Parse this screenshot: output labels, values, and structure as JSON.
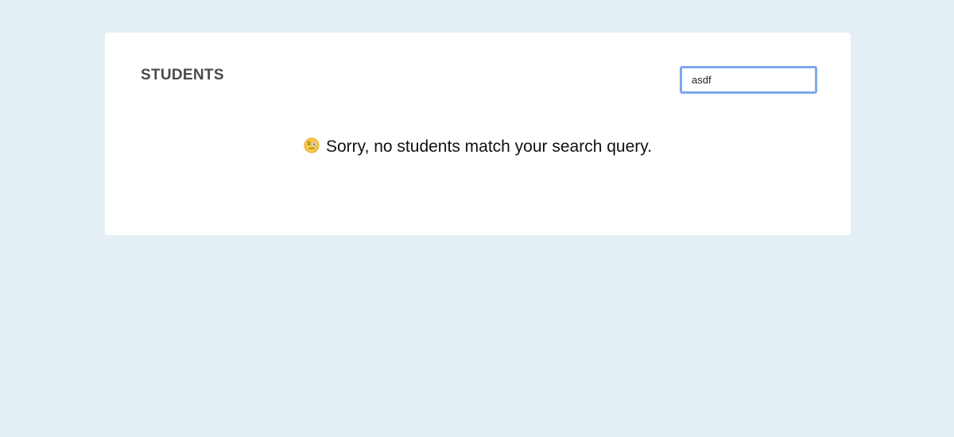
{
  "page": {
    "background_color": "#e3eff5"
  },
  "students": {
    "title": "STUDENTS",
    "search": {
      "value": "asdf",
      "placeholder": "",
      "focus_color": "#7fa8ec"
    },
    "empty_state": {
      "icon": "face-with-monocle-icon",
      "message": "Sorry, no students match your search query."
    }
  }
}
